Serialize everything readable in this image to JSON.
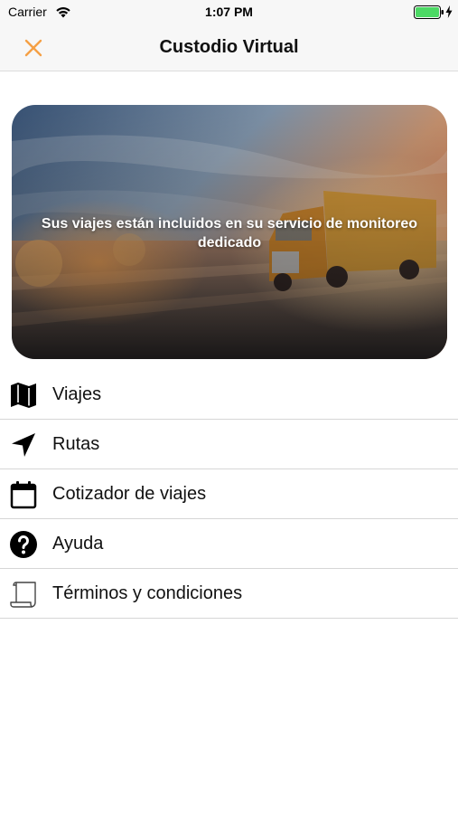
{
  "status_bar": {
    "carrier": "Carrier",
    "time": "1:07 PM",
    "battery_color": "#4cd964"
  },
  "nav": {
    "title": "Custodio Virtual",
    "close_icon": "close-icon",
    "accent_color": "#f5a045"
  },
  "banner": {
    "text": "Sus viajes están incluidos en su servicio de monitoreo dedicado"
  },
  "menu": {
    "items": [
      {
        "label": "Viajes",
        "icon": "map-icon"
      },
      {
        "label": "Rutas",
        "icon": "navigation-arrow-icon"
      },
      {
        "label": "Cotizador de viajes",
        "icon": "calendar-icon"
      },
      {
        "label": "Ayuda",
        "icon": "help-icon"
      },
      {
        "label": "Términos y condiciones",
        "icon": "document-icon"
      }
    ]
  }
}
